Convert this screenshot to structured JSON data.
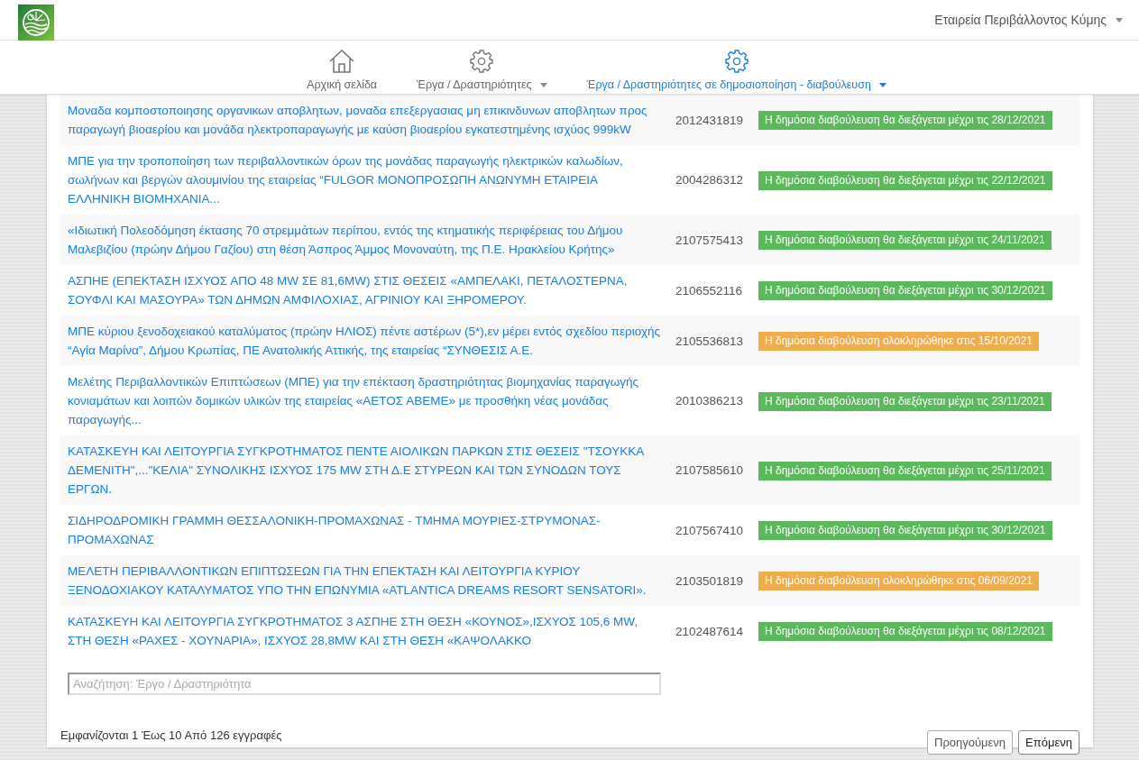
{
  "header": {
    "user_menu": "Εταιρεία Περιβάλλοντος Κύμης",
    "nav": [
      {
        "label": "Αρχική σελίδα",
        "kind": "home",
        "dropdown": false,
        "selected": false
      },
      {
        "label": "Έργα / Δραστηριότητες",
        "kind": "gear",
        "dropdown": true,
        "selected": false
      },
      {
        "label": "Έργα / Δραστηριότητες σε δημοσιοποίηση - διαβούλευση",
        "kind": "gear",
        "dropdown": true,
        "selected": true
      }
    ]
  },
  "table": {
    "rows": [
      {
        "title": "Μοναδα κομποστοποιησης οργανικων αποβλητων, μοναδα επεξεργασιας μη επικινδυνων αποβλητων προς παραγωγή βιοαερίου και μονάδα ηλεκτροπαραγωγής με καύση βιοαερίου εγκατεστημένης ισχύος 999kW",
        "id": "2012431819",
        "status": "Η δημόσια διαβούλευση θα διεξάγεται μέχρι τις 28/12/2021",
        "kind": "open"
      },
      {
        "title": "ΜΠΕ για την τροποποίηση των περιβαλλοντικών όρων της μονάδας παραγωγής ηλεκτρικών καλωδίων, σωλήνων και βεργών αλουμινίου της εταιρείας “FULGOR ΜΟΝΟΠΡΟΣΩΠΗ ΑΝΩΝΥΜΗ ΕΤΑΙΡΕΙΑ ΕΛΛΗΝΙΚΗ ΒΙΟΜΗΧΑΝΙΑ...",
        "id": "2004286312",
        "status": "Η δημόσια διαβούλευση θα διεξάγεται μέχρι τις 22/12/2021",
        "kind": "open"
      },
      {
        "title": "«Ιδιωτική Πολεοδόμηση έκτασης 70 στρεμμάτων περίπου, εντός της κτηματικής περιφέρειας του Δήμου Μαλεβιζίου (πρώην Δήμου Γαζίου) στη θέση Άσπρος Άμμος Μονοναύτη, της Π.Ε. Ηρακλείου Κρήτης»",
        "id": "2107575413",
        "status": "Η δημόσια διαβούλευση θα διεξάγεται μέχρι τις 24/11/2021",
        "kind": "open"
      },
      {
        "title": "ΑΣΠΗΕ (ΕΠΕΚΤΑΣΗ ΙΣΧΥΟΣ ΑΠΟ 48 MW ΣΕ 81,6MW) ΣΤΙΣ ΘΕΣΕΙΣ «ΑΜΠΕΛΑΚΙ, ΠΕΤΑΛΟΣΤΕΡΝΑ, ΣΟΥΦΛΙ ΚΑΙ ΜΑΣΟΥΡΑ» ΤΩΝ ΔΗΜΩΝ ΑΜΦΙΛΟΧΙΑΣ, ΑΓΡΙΝΙΟΥ ΚΑΙ ΞΗΡΟΜΕΡΟΥ.",
        "id": "2106552116",
        "status": "Η δημόσια διαβούλευση θα διεξάγεται μέχρι τις 30/12/2021",
        "kind": "open"
      },
      {
        "title": "ΜΠΕ κύριου ξενοδοχειακού καταλύματος (πρώην ΗΛΙΟΣ) πέντε αστέρων (5*),εν μέρει εντός σχεδίου περιοχής “Αγία Μαρίνα”, Δήμου Κρωπίας, ΠΕ Ανατολικής Αττικής, της εταιρείας “ΣΥΝΘΕΣΙΣ Α.Ε.",
        "id": "2105536813",
        "status": "Η δημόσια διαβούλευση ολοκληρώθηκε στις 15/10/2021",
        "kind": "closed"
      },
      {
        "title": "Μελέτης Περιβαλλοντικών Επιπτώσεων (ΜΠΕ) για την επέκταση δραστηριότητας βιομηχανίας παραγωγής κονιαμάτων και λοιπών δομικών υλικών της εταιρείας «ΑΕΤΟΣ ΑΒΕΜΕ» με προσθήκη νέας μονάδας παραγωγής...",
        "id": "2010386213",
        "status": "Η δημόσια διαβούλευση θα διεξάγεται μέχρι τις 23/11/2021",
        "kind": "open"
      },
      {
        "title": "ΚΑΤΑΣΚΕΥΗ ΚΑΙ ΛΕΙΤΟΥΡΓΙΑ ΣΥΓΚΡΟΤΗΜΑΤΟΣ ΠΕΝΤΕ ΑΙΟΛΙΚΩΝ ΠΑΡΚΩΝ ΣΤΙΣ ΘΕΣΕΙΣ \"ΤΣΟΥΚΚΑ ΔΕΜΕΝΙΤΗ\",...\"ΚΕΛΙΑ\" ΣΥΝΟΛΙΚΗΣ ΙΣΧΥΟΣ 175 MW ΣΤΗ Δ.Ε ΣΤΥΡΕΩΝ ΚΑΙ ΤΩΝ ΣΥΝΟΔΩΝ ΤΟΥΣ ΕΡΓΩΝ.",
        "id": "2107585610",
        "status": "Η δημόσια διαβούλευση θα διεξάγεται μέχρι τις 25/11/2021",
        "kind": "open"
      },
      {
        "title": "ΣΙΔΗΡΟΔΡΟΜΙΚΗ ΓΡΑΜΜΗ ΘΕΣΣΑΛΟΝΙΚΗ-ΠΡΟΜΑΧΩΝΑΣ - ΤΜΗΜΑ ΜΟΥΡΙΕΣ-ΣΤΡΥΜΟΝΑΣ-ΠΡΟΜΑΧΩΝΑΣ",
        "id": "2107567410",
        "status": "Η δημόσια διαβούλευση θα διεξάγεται μέχρι τις 30/12/2021",
        "kind": "open"
      },
      {
        "title": "ΜΕΛΕΤΗ ΠΕΡΙΒΑΛΛΟΝΤΙΚΩΝ ΕΠΙΠΤΩΣΕΩΝ ΓΙΑ ΤΗΝ ΕΠΕΚΤΑΣΗ ΚΑΙ ΛΕΙΤΟΥΡΓΙΑ ΚΥΡΙΟΥ ΞΕΝΟΔΟΧΙΑΚΟΥ ΚΑΤΑΛΥΜΑΤΟΣ ΥΠΟ ΤΗΝ ΕΠΩΝΥΜΙΑ «ATLANTICA DREAMS RESORT SENSATORI».",
        "id": "2103501819",
        "status": "Η δημόσια διαβούλευση ολοκληρώθηκε στις 06/09/2021",
        "kind": "closed"
      },
      {
        "title": "ΚΑΤΑΣΚΕΥΗ ΚΑΙ ΛΕΙΤΟΥΡΓΙΑ ΣΥΓΚΡΟΤΗΜΑΤΟΣ 3 ΑΣΠΗΕ ΣΤΗ ΘΕΣΗ «ΚΟΥΝΟΣ»,ΙΣΧΥΟΣ 105,6 MW, ΣΤΗ ΘΕΣΗ «ΡΑΧΕΣ - ΧΟΥΝΑΡΙΑ», ΙΣΧΥΟΣ 28,8MW ΚΑΙ ΣΤΗ ΘΕΣΗ «ΚΑΨΟΛΑΚΚΟ",
        "id": "2102487614",
        "status": "Η δημόσια διαβούλευση θα διεξάγεται μέχρι τις 08/12/2021",
        "kind": "open"
      }
    ],
    "filter": {
      "placeholder": "Αναζήτηση: Έργο / Δραστηριότητα"
    }
  },
  "footer": {
    "info": "Εμφανίζονται 1 Έως 10 Από 126 εγγραφές",
    "buttons": [
      "Προηγούμενη",
      "Επόμενη"
    ]
  }
}
